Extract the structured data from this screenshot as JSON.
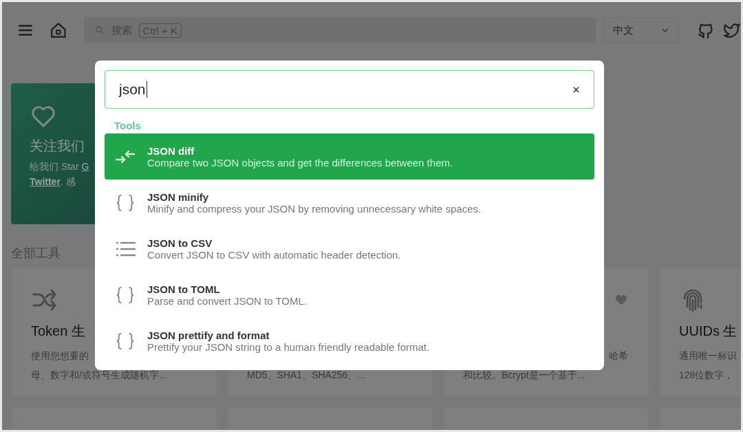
{
  "header": {
    "search": {
      "placeholder": "搜索",
      "shortcut": "Ctrl + K"
    },
    "language": "中文"
  },
  "hero": {
    "title": "关注我们",
    "line1_text": "给我们 Star",
    "line1_link": "G",
    "line2_link": "Twitter",
    "line2_text": ". 感"
  },
  "section_title": "全部工具",
  "tool_cards": [
    {
      "kind": "shuffle",
      "title": "Token 生",
      "description": [
        "使用您想要的",
        "母、数字和/或符号生成随机字..."
      ]
    },
    {
      "kind": "plain",
      "description": [
        "MD5、SHA1、SHA256、..."
      ]
    },
    {
      "kind": "favorite",
      "description": [
        "哈希",
        "和比较。Bcrypt是一个基于..."
      ]
    },
    {
      "kind": "fingerprint",
      "title": "UUIDs 生",
      "description": [
        "通用唯一标识",
        "128位数字，"
      ]
    }
  ],
  "search_dialog": {
    "query": "json",
    "group_label": "Tools",
    "results": [
      {
        "kind": "compare",
        "title": "JSON diff",
        "description": "Compare two JSON objects and get the differences between them.",
        "selected": true
      },
      {
        "kind": "braces",
        "title": "JSON minify",
        "description": "Minify and compress your JSON by removing unnecessary white spaces.",
        "selected": false
      },
      {
        "kind": "list",
        "title": "JSON to CSV",
        "description": "Convert JSON to CSV with automatic header detection.",
        "selected": false
      },
      {
        "kind": "braces",
        "title": "JSON to TOML",
        "description": "Parse and convert JSON to TOML.",
        "selected": false
      },
      {
        "kind": "braces",
        "title": "JSON prettify and format",
        "description": "Prettify your JSON string to a human friendly readable format.",
        "selected": false
      }
    ]
  }
}
